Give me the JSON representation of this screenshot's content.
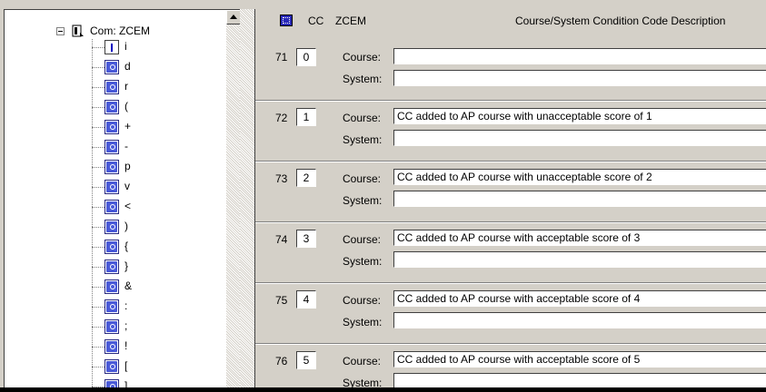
{
  "tree": {
    "root_label": "Com: ZCEM",
    "nodes": [
      {
        "icon": "info-icon",
        "label": "i"
      },
      {
        "icon": "condition-icon",
        "label": "d"
      },
      {
        "icon": "condition-icon",
        "label": "r"
      },
      {
        "icon": "condition-icon",
        "label": "("
      },
      {
        "icon": "condition-icon",
        "label": "+"
      },
      {
        "icon": "condition-icon",
        "label": "-"
      },
      {
        "icon": "condition-icon",
        "label": "p"
      },
      {
        "icon": "condition-icon",
        "label": "v"
      },
      {
        "icon": "condition-icon",
        "label": "<"
      },
      {
        "icon": "condition-icon",
        "label": ")"
      },
      {
        "icon": "condition-icon",
        "label": "{"
      },
      {
        "icon": "condition-icon",
        "label": "}"
      },
      {
        "icon": "condition-icon",
        "label": "&"
      },
      {
        "icon": "condition-icon",
        "label": ":"
      },
      {
        "icon": "condition-icon",
        "label": ";"
      },
      {
        "icon": "condition-icon",
        "label": "!"
      },
      {
        "icon": "condition-icon",
        "label": "["
      },
      {
        "icon": "condition-icon",
        "label": "]"
      }
    ]
  },
  "header": {
    "cc": "CC",
    "zcem": "ZCEM",
    "description": "Course/System Condition Code Description"
  },
  "labels": {
    "course": "Course:",
    "system": "System:"
  },
  "records": [
    {
      "num": "71",
      "code": "0",
      "course": "",
      "system": ""
    },
    {
      "num": "72",
      "code": "1",
      "course": "CC added to AP course with unacceptable score of 1",
      "system": ""
    },
    {
      "num": "73",
      "code": "2",
      "course": "CC added to AP course with unacceptable score of 2",
      "system": ""
    },
    {
      "num": "74",
      "code": "3",
      "course": "CC added to AP course with acceptable score of 3",
      "system": ""
    },
    {
      "num": "75",
      "code": "4",
      "course": "CC added to AP course with acceptable score of 4",
      "system": ""
    },
    {
      "num": "76",
      "code": "5",
      "course": "CC added to AP course with acceptable score of 5",
      "system": ""
    }
  ]
}
